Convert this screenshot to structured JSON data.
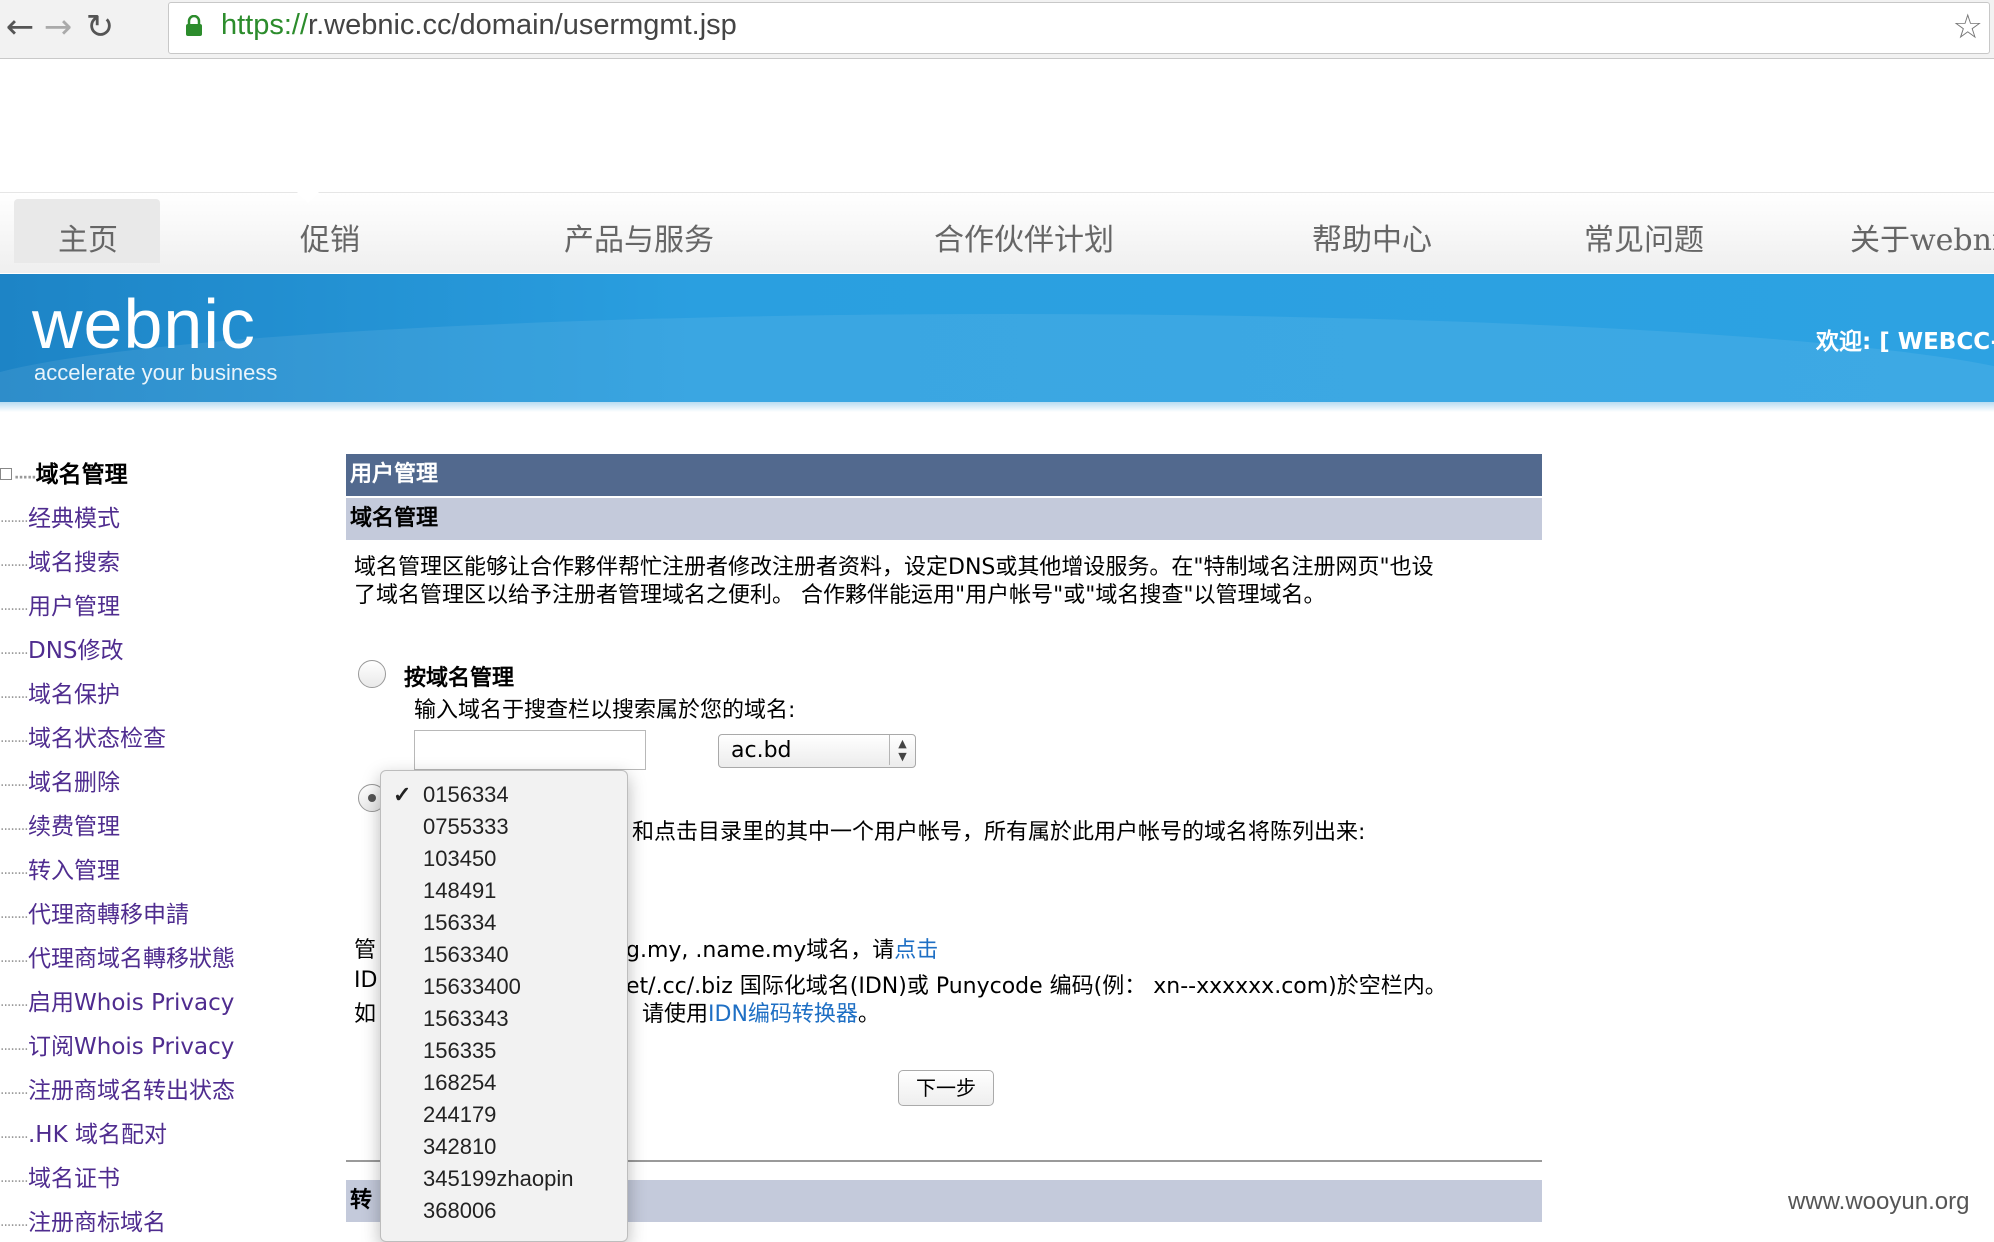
{
  "browser": {
    "back_icon": "arrow-left-icon",
    "forward_icon": "arrow-right-icon",
    "reload_icon": "reload-icon",
    "url_scheme": "https://",
    "url_rest": "r.webnic.cc/domain/usermgmt.jsp"
  },
  "topnav": {
    "items": [
      "主页",
      "促销",
      "产品与服务",
      "合作伙伴计划",
      "帮助中心",
      "常见问题",
      "关于webnic"
    ]
  },
  "banner": {
    "logo": "webnic",
    "tagline": "accelerate your business",
    "welcome": "欢迎: [ WEBCC-"
  },
  "sidebar": {
    "root": "域名管理",
    "items": [
      "经典模式",
      "域名搜索",
      "用户管理",
      "DNS修改",
      "域名保护",
      "域名状态检查",
      "域名删除",
      "续费管理",
      "转入管理",
      "代理商轉移申請",
      "代理商域名轉移狀態",
      "启用Whois Privacy",
      "订阅Whois Privacy",
      "注册商域名转出状态",
      ".HK 域名配对",
      "域名证书",
      "注册商标域名"
    ]
  },
  "main": {
    "header": "用户管理",
    "subheader": "域名管理",
    "desc_line1": "域名管理区能够让合作夥伴帮忙注册者修改注册者资料，设定DNS或其他增设服务。在\"特制域名注册网页\"也设",
    "desc_line2": "了域名管理区以给予注册者管理域名之便利。 合作夥伴能运用\"用户帐号\"或\"域名搜查\"以管理域名。",
    "opt1_label": "按域名管理",
    "opt1_hint": "输入域名于搜查栏以搜索属於您的域名:",
    "domain_input_value": "",
    "tld_selected": "ac.bd",
    "opt2_text": "和点击目录里的其中一个用户帐号，所有属於此用户帐号的域名将陈列出来:",
    "note1_start": "管",
    "note1_text": "g.my, .name.my域名，请",
    "note1_link": "点击",
    "note2_start": "ID",
    "note2_text": "et/.cc/.biz 国际化域名(IDN)或 Punycode 编码(例：  xn--xxxxxx.com)於空栏内。",
    "note3_start": "如",
    "note3_text": "请使用",
    "note3_link": "IDN编码转换器",
    "note3_end": "。",
    "next_button": "下一步",
    "section3_header": "转"
  },
  "dropdown": {
    "selected": "0156334",
    "options": [
      "0156334",
      "0755333",
      "103450",
      "148491",
      "156334",
      "1563340",
      "15633400",
      "1563343",
      "156335",
      "168254",
      "244179",
      "342810",
      "345199zhaopin",
      "368006",
      ""
    ]
  },
  "watermark": "www.wooyun.org",
  "colors": {
    "header_dark": "#52698e",
    "header_light": "#c4cadb",
    "banner_blue": "#2a9fe0",
    "sidebar_link": "#4f2c8f",
    "link_blue": "#1e6fc4"
  }
}
